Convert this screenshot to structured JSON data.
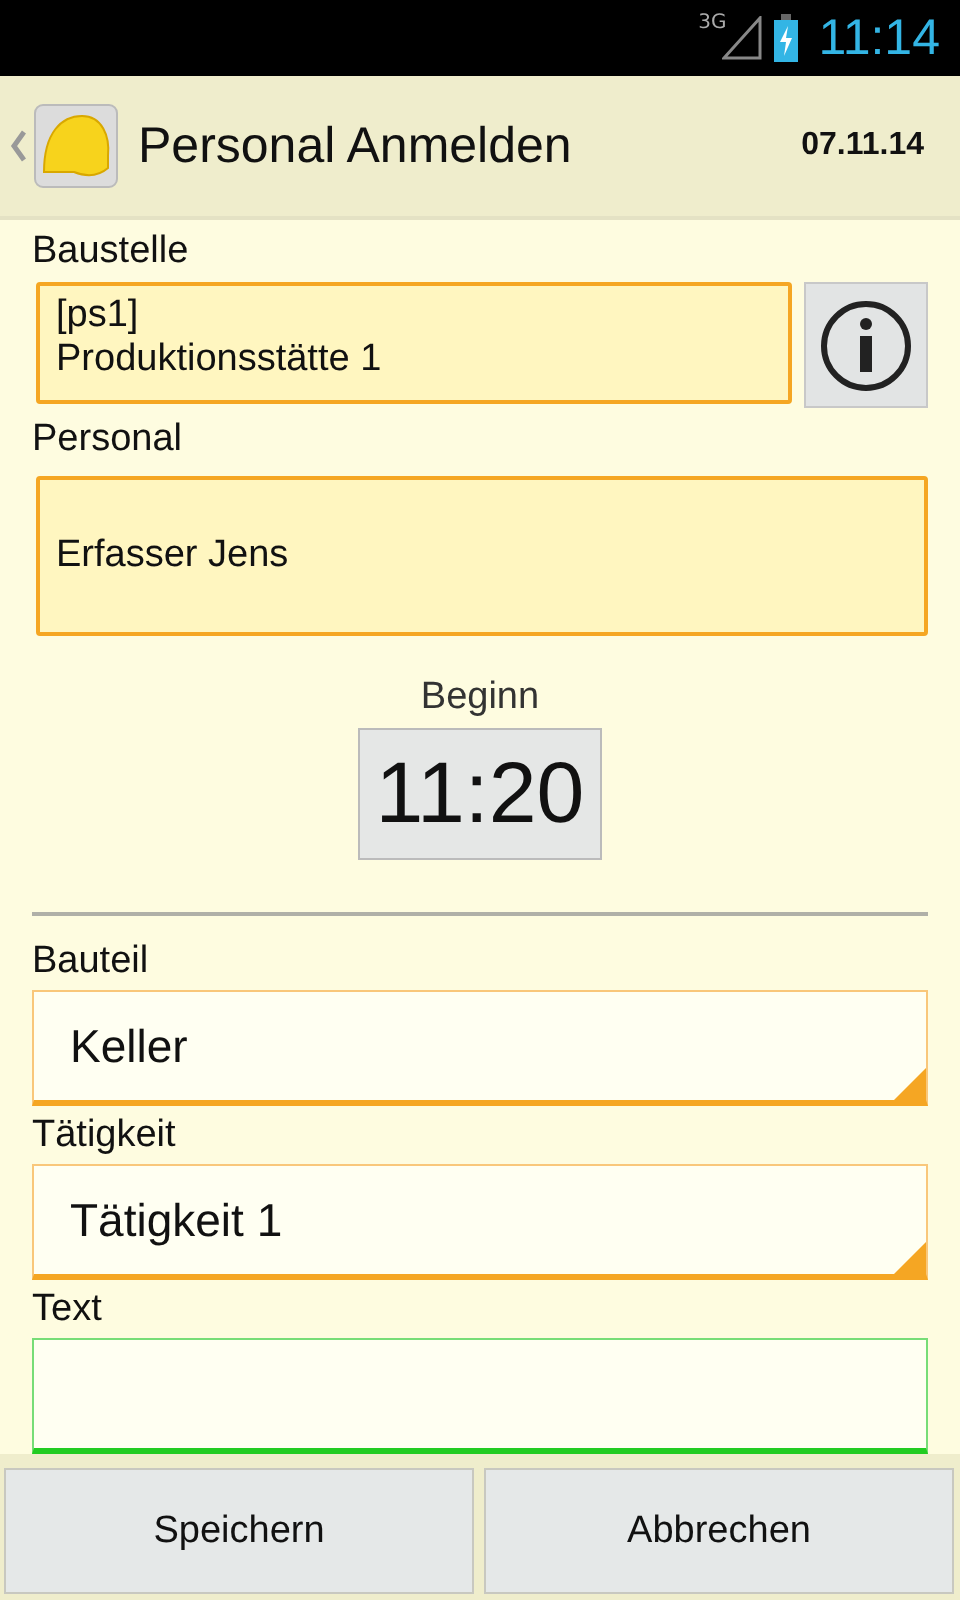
{
  "status_bar": {
    "network": "3G",
    "time": "11:14",
    "charging": true
  },
  "action_bar": {
    "title": "Personal Anmelden",
    "date": "07.11.14"
  },
  "baustelle": {
    "label": "Baustelle",
    "lines": [
      "[ps1]",
      "Produktionsstätte 1"
    ]
  },
  "personal": {
    "label": "Personal",
    "value": "Erfasser Jens"
  },
  "beginn": {
    "label": "Beginn",
    "time": "11:20"
  },
  "fields": [
    {
      "kind": "spinner",
      "label": "Bauteil",
      "value": "Keller",
      "focused": false
    },
    {
      "kind": "spinner",
      "label": "Tätigkeit",
      "value": "Tätigkeit 1",
      "focused": false
    },
    {
      "kind": "text",
      "label": "Text",
      "focused": true
    }
  ],
  "buttons": [
    "Speichern",
    "Abbrechen"
  ]
}
